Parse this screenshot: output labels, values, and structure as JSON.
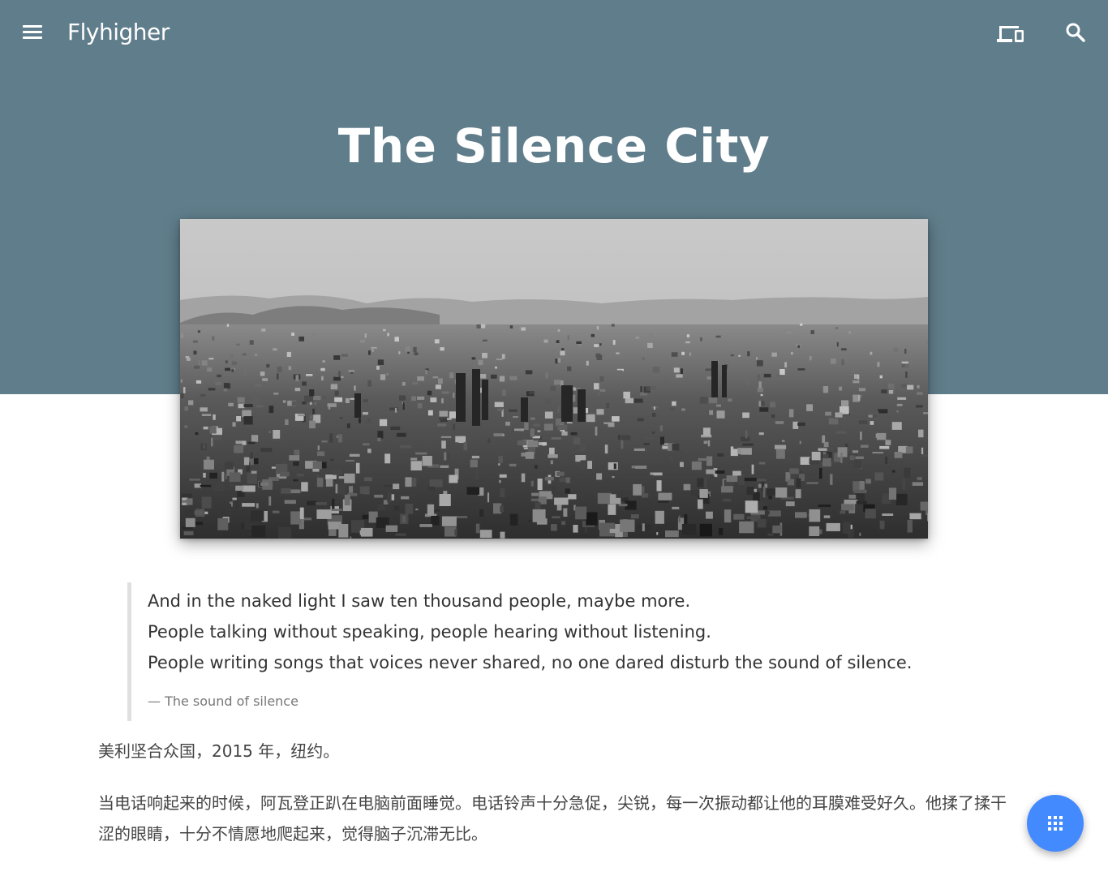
{
  "header": {
    "brand": "Flyhigher",
    "menu_icon": "menu-icon",
    "device_icon": "devices-icon",
    "search_icon": "search-icon",
    "background_color": "#607d8b"
  },
  "post": {
    "title": "The Silence City",
    "cover_image": "black-and-white aerial city photo",
    "quote": {
      "lines": [
        "And in the naked light I saw ten thousand people, maybe more.",
        "People talking without speaking, people hearing without listening.",
        "People writing songs that voices never shared, no one dared disturb the sound of silence."
      ],
      "cite": "— The sound of silence"
    },
    "paragraphs": [
      "美利坚合众国，2015 年，纽约。",
      "当电话响起来的时候，阿瓦登正趴在电脑前面睡觉。电话铃声十分急促，尖锐，每一次振动都让他的耳膜难受好久。他揉了揉干涩的眼睛，十分不情愿地爬起来，觉得脑子沉滞无比。"
    ]
  },
  "fab": {
    "icon": "apps-grid-icon",
    "color": "#448aff"
  }
}
